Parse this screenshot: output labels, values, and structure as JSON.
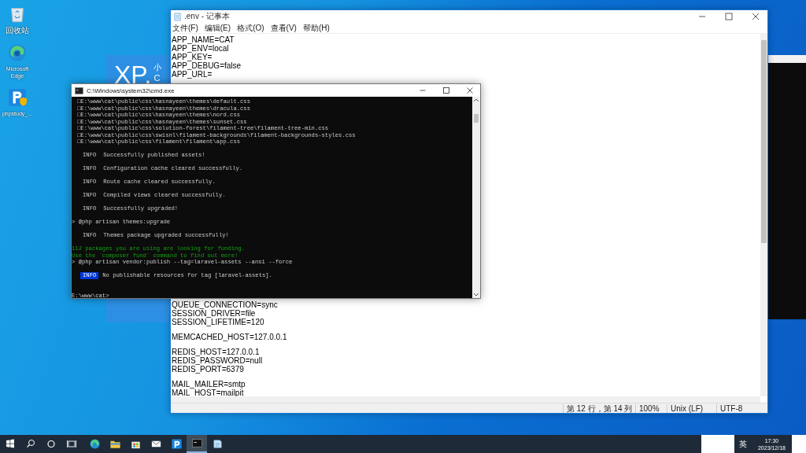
{
  "desktop": {
    "icons": [
      {
        "kind": "recycle",
        "label": "回收站"
      },
      {
        "kind": "edge",
        "label": "Microsoft Edge"
      },
      {
        "kind": "phpstudy",
        "label": "phpstudy_..."
      }
    ]
  },
  "background_panel": {
    "logo": "XP.",
    "text_1": "小",
    "text_2": "C"
  },
  "notepad": {
    "title": ".env - 记事本",
    "menu": [
      "文件(F)",
      "编辑(E)",
      "格式(O)",
      "查看(V)",
      "帮助(H)"
    ],
    "top_blocks": [
      [
        "APP_NAME=CAT",
        "APP_ENV=local",
        "APP_KEY=",
        "APP_DEBUG=false",
        "APP_URL="
      ]
    ],
    "bottom_blocks": [
      [
        "QUEUE_CONNECTION=sync",
        "SESSION_DRIVER=file",
        "SESSION_LIFETIME=120"
      ],
      [
        "MEMCACHED_HOST=127.0.0.1"
      ],
      [
        "REDIS_HOST=127.0.0.1",
        "REDIS_PASSWORD=null",
        "REDIS_PORT=6379"
      ],
      [
        "MAIL_MAILER=smtp",
        "MAIL_HOST=mailpit"
      ]
    ],
    "status": {
      "position": "第 12 行，第 14 列",
      "zoom": "100%",
      "line_ending": "Unix (LF)",
      "encoding": "UTF-8"
    }
  },
  "cmd": {
    "title": "C:\\Windows\\system32\\cmd.exe",
    "lines": [
      {
        "kind": "output",
        "text": "□E:\\www\\cat\\public\\css\\hasnayeen\\themes\\default.css"
      },
      {
        "kind": "output",
        "text": "□E:\\www\\cat\\public\\css\\hasnayeen\\themes\\dracula.css"
      },
      {
        "kind": "output",
        "text": "□E:\\www\\cat\\public\\css\\hasnayeen\\themes\\nord.css"
      },
      {
        "kind": "output",
        "text": "□E:\\www\\cat\\public\\css\\hasnayeen\\themes\\sunset.css"
      },
      {
        "kind": "output",
        "text": "□E:\\www\\cat\\public\\css\\solution-forest\\filament-tree\\filament-tree-min.css"
      },
      {
        "kind": "output",
        "text": "□E:\\www\\cat\\public\\css\\swisnl\\filament-backgrounds\\filament-backgrounds-styles.css"
      },
      {
        "kind": "output",
        "text": "□E:\\www\\cat\\public\\css\\filament\\filament\\app.css"
      },
      {
        "kind": "info",
        "label": "INFO",
        "text": "Successfully published assets!",
        "highlighted": false
      },
      {
        "kind": "info",
        "label": "INFO",
        "text": "Configuration cache cleared successfully.",
        "highlighted": false
      },
      {
        "kind": "info",
        "label": "INFO",
        "text": "Route cache cleared successfully.",
        "highlighted": false
      },
      {
        "kind": "info",
        "label": "INFO",
        "text": "Compiled views cleared successfully.",
        "highlighted": false
      },
      {
        "kind": "info",
        "label": "INFO",
        "text": "Successfully upgraded!",
        "highlighted": false
      },
      {
        "kind": "prompt",
        "text": "> @php artisan themes:upgrade"
      },
      {
        "kind": "info",
        "label": "INFO",
        "text": "Themes package upgraded successfully!",
        "highlighted": false
      },
      {
        "kind": "funding",
        "text": "112 packages you are using are looking for funding."
      },
      {
        "kind": "funding",
        "text": "Use the `composer fund` command to find out more!"
      },
      {
        "kind": "prompt",
        "text": "> @php artisan vendor:publish --tag=laravel-assets --ansi --force"
      },
      {
        "kind": "info",
        "label": "INFO",
        "text": "No publishable resources for tag [laravel-assets].",
        "highlighted": true
      },
      {
        "kind": "cwd",
        "text": "E:\\www\\cat>"
      }
    ]
  },
  "taskbar": {
    "apps": [
      {
        "kind": "edge",
        "selected": false
      },
      {
        "kind": "explorer",
        "selected": false
      },
      {
        "kind": "store",
        "selected": false
      },
      {
        "kind": "mail",
        "selected": false
      },
      {
        "kind": "phpstudy",
        "selected": false
      },
      {
        "kind": "cmd",
        "selected": true
      },
      {
        "kind": "notepad",
        "selected": false
      }
    ],
    "ime": "英",
    "time": "17:30",
    "date": "2023/12/18"
  }
}
